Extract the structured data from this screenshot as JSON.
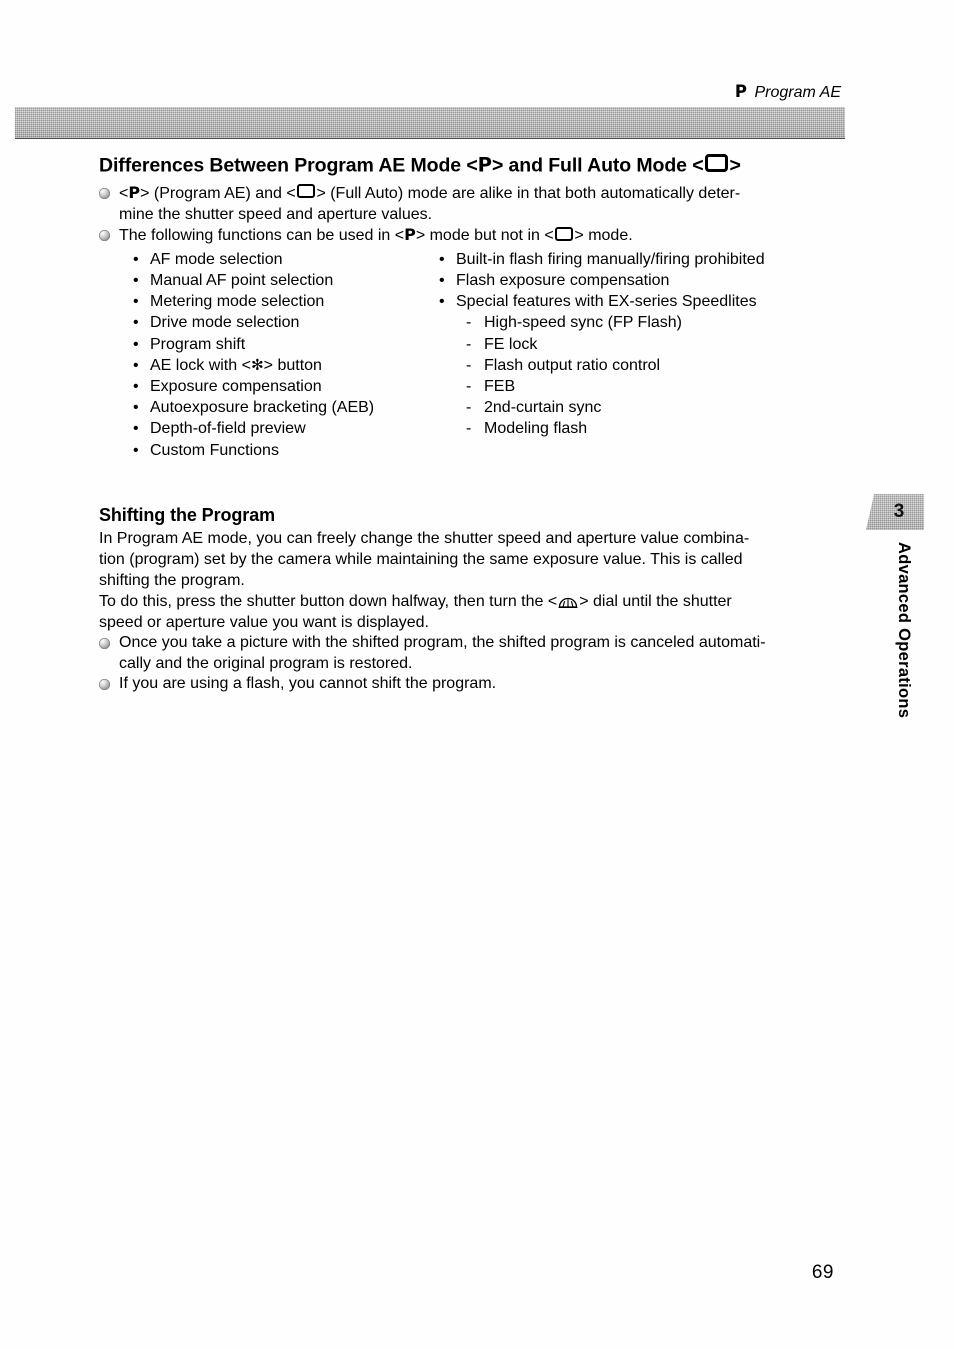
{
  "running_header": {
    "mode_glyph": "P",
    "text": "Program AE"
  },
  "section": {
    "title_part1": "Differences Between Program AE Mode <",
    "title_glyph_p": "P",
    "title_part2": "> and Full Auto Mode <",
    "title_part3": ">",
    "intro_bullets": [
      {
        "line1_a": "<",
        "glyph1": "P",
        "line1_b": "> (Program AE) and <",
        "line1_c": "> (Full Auto) mode are alike in that both automatically deter-",
        "line2": "mine the shutter speed and aperture values."
      },
      {
        "line1_a": "The following functions can be used in <",
        "glyph1": "P",
        "line1_b": "> mode but not in <",
        "line1_c": "> mode."
      }
    ],
    "left_column": [
      "AF mode selection",
      "Manual AF point selection",
      "Metering mode selection",
      "Drive mode selection",
      "Program shift",
      "AE_LOCK_SPECIAL",
      "Exposure compensation",
      "Autoexposure bracketing (AEB)",
      "Depth-of-field preview",
      "Custom Functions"
    ],
    "ae_lock_item": {
      "before": "AE lock with <",
      "star_glyph": "✻",
      "after": "> button"
    },
    "right_column": [
      "Built-in flash firing manually/firing prohibited",
      "Flash exposure compensation",
      "Special features with EX-series Speedlites"
    ],
    "right_sub_items": [
      "High-speed sync (FP Flash)",
      "FE lock",
      "Flash output ratio control",
      "FEB",
      "2nd-curtain sync",
      "Modeling flash"
    ],
    "bullet_marker": "•",
    "dash_marker": "-"
  },
  "shifting": {
    "heading": "Shifting the Program",
    "para1_line1": "In Program AE mode, you can freely change the shutter speed and aperture value combina-",
    "para1_line2": "tion (program) set by the camera while maintaining the same exposure value. This is called",
    "para1_line3": "shifting the program.",
    "para2_before": "To do this, press the shutter button down halfway, then turn the <",
    "para2_after": "> dial until the shutter",
    "para2_line2": "speed or aperture value you want is displayed.",
    "bullets": [
      {
        "line1": "Once you take a picture with the shifted program, the shifted program is canceled automati-",
        "line2": "cally and the original program is restored."
      },
      {
        "line1": "If you are using a flash, you cannot shift the program."
      }
    ]
  },
  "chapter_tab": {
    "number": "3",
    "label": "Advanced Operations"
  },
  "folio": {
    "page_number": "69"
  },
  "colors": {
    "band_gray": "#b0b0b0",
    "tab_gray": "#b5b5b5",
    "text": "#000000"
  }
}
